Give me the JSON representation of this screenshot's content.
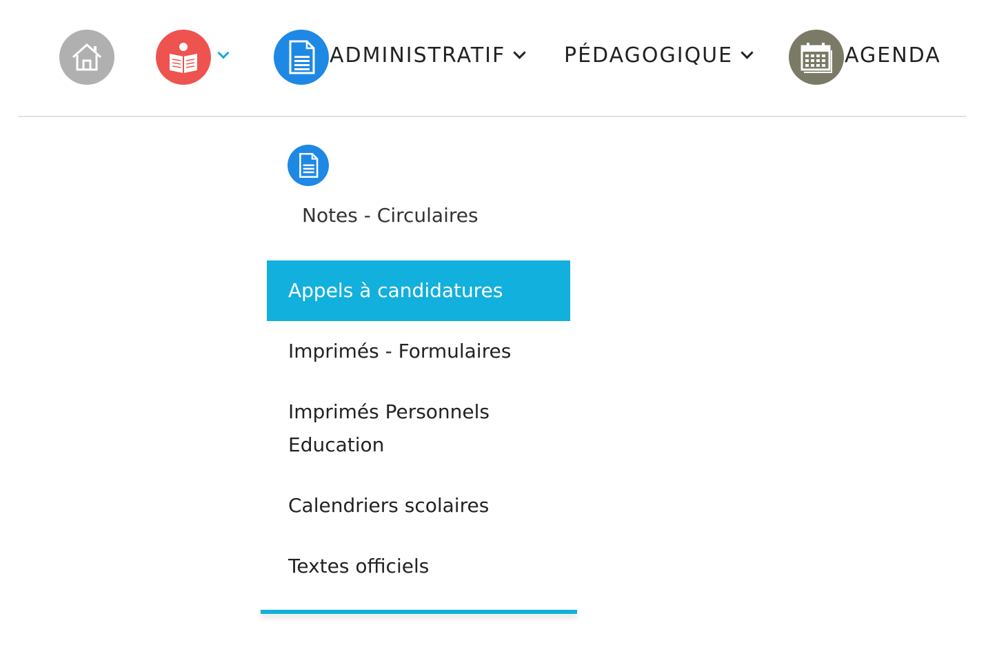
{
  "nav": {
    "items": [
      {
        "label": "ADMINISTRATIF",
        "icon": "document-icon",
        "color": "#1e88e5"
      },
      {
        "label": "PÉDAGOGIQUE"
      },
      {
        "label": "AGENDA",
        "icon": "calendar-icon",
        "color": "#7a7a66"
      }
    ],
    "home_icon": "home-icon",
    "book_icon": "book-icon",
    "home_color": "#b0b0b0",
    "book_color": "#ef5350",
    "accent_color": "#12b0dd"
  },
  "dropdown": {
    "icon": "document-icon",
    "heading": "Notes - Circulaires",
    "items": [
      {
        "label": "Appels à candidatures",
        "active": true
      },
      {
        "label": "Imprimés - Formulaires"
      },
      {
        "label": "Imprimés Personnels Education"
      },
      {
        "label": "Calendriers scolaires"
      },
      {
        "label": "Textes officiels"
      }
    ]
  }
}
